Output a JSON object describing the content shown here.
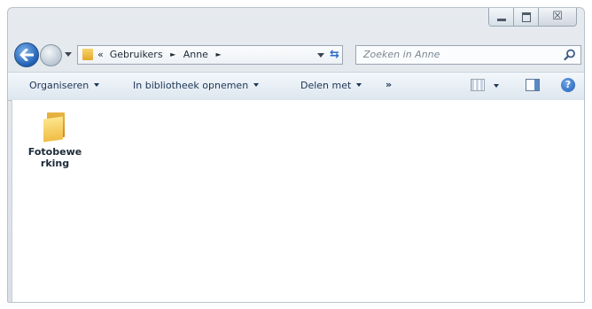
{
  "window": {
    "caption": {
      "minimize": "minimize-icon",
      "maximize": "maximize-icon",
      "close_label": "☒"
    }
  },
  "nav": {
    "back_icon": "back-arrow-icon",
    "forward_icon": "forward-arrow-icon",
    "address": {
      "prefix": "«",
      "segments": [
        "Gebruikers",
        "Anne"
      ],
      "separator": "►"
    },
    "refresh_icon": "refresh-icon",
    "search": {
      "placeholder": "Zoeken in Anne",
      "icon": "magnifier-icon"
    }
  },
  "commandbar": {
    "organize": "Organiseren",
    "include_library": "In bibliotheek opnemen",
    "share": "Delen met",
    "more": "»",
    "view_icon": "change-view-icon",
    "preview_pane_icon": "preview-pane-icon",
    "help": "?"
  },
  "content": {
    "items": [
      {
        "label": "Fotobewerking",
        "icon": "folder-icon"
      }
    ]
  },
  "colors": {
    "window_frame": "#d9e0e7",
    "command_bar": "#dde6ef",
    "link_text": "#1c3556",
    "accent_blue": "#1f5fb2",
    "folder_yellow": "#f0bd44"
  }
}
